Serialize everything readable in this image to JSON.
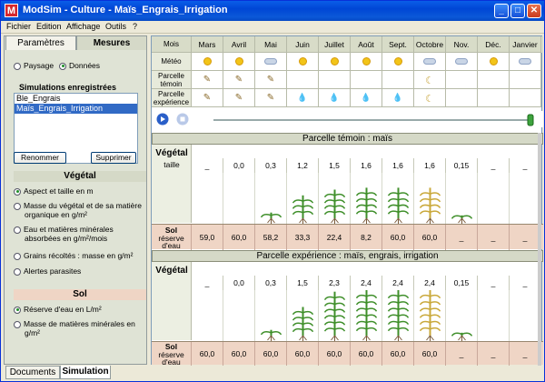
{
  "window": {
    "app_icon": "M",
    "title": "ModSim - Culture  - Maïs_Engrais_Irrigation"
  },
  "titlebar_buttons": {
    "minimize": "_",
    "maximize": "□",
    "close": "✕"
  },
  "menu": [
    "Fichier",
    "Edition",
    "Affichage",
    "Outils",
    "?"
  ],
  "left": {
    "tabs": [
      "Paramètres",
      "Mesures"
    ],
    "active_tab": "Mesures",
    "view_options": [
      "Paysage",
      "Données"
    ],
    "view_selected": "Données",
    "sims_title": "Simulations enregistrées",
    "simulations": [
      "Ble_Engrais",
      "Maïs_Engrais_Irrigation"
    ],
    "selected_simulation": "Maïs_Engrais_Irrigation",
    "rename_label": "Renommer",
    "delete_label": "Supprimer",
    "vegetal_title": "Végétal",
    "vegetal_options": [
      "Aspect et taille en m",
      "Masse du végétal et de sa matière organique en g/m²",
      "Eau et matières minérales absorbées en g/m²/mois",
      "Grains récoltés : masse en g/m²",
      "Alertes parasites"
    ],
    "vegetal_selected": "Aspect et taille en m",
    "sol_title": "Sol",
    "sol_options": [
      "Réserve d'eau en L/m²",
      "Masse de matières minérales en g/m²"
    ],
    "sol_selected": "Réserve d'eau en L/m²"
  },
  "bottom_tabs": [
    "Documents",
    "Simulation"
  ],
  "bottom_active": "Simulation",
  "grid": {
    "row_labels": {
      "mois": "Mois",
      "meteo": "Météo",
      "temoin": "Parcelle témoin",
      "experience": "Parcelle expérience"
    },
    "months": [
      "Mars",
      "Avril",
      "Mai",
      "Juin",
      "Juillet",
      "Août",
      "Sept.",
      "Octobre",
      "Nov.",
      "Déc.",
      "Janvier"
    ]
  },
  "section1": {
    "title": "Parcelle témoin : maïs",
    "vegetal_label": "Végétal",
    "taille_label": "taille",
    "sizes": [
      "_",
      "0,0",
      "0,3",
      "1,2",
      "1,5",
      "1,6",
      "1,6",
      "1,6",
      "0,15",
      "_",
      "_"
    ],
    "sol_label": "Sol",
    "reserve_label": "réserve d'eau",
    "water": [
      "59,0",
      "60,0",
      "58,2",
      "33,3",
      "22,4",
      "8,2",
      "60,0",
      "60,0",
      "_",
      "_",
      "_"
    ]
  },
  "section2": {
    "title": "Parcelle expérience : maïs, engrais, irrigation",
    "vegetal_label": "Végétal",
    "sizes": [
      "_",
      "0,0",
      "0,3",
      "1,5",
      "2,3",
      "2,4",
      "2,4",
      "2,4",
      "0,15",
      "_",
      "_"
    ],
    "sol_label": "Sol",
    "reserve_label": "réserve d'eau",
    "water": [
      "60,0",
      "60,0",
      "60,0",
      "60,0",
      "60,0",
      "60,0",
      "60,0",
      "60,0",
      "_",
      "_",
      "_"
    ]
  },
  "colors": {
    "selection": "#316ac5",
    "soil": "#efd5c5",
    "header": "#d5d9c7"
  }
}
